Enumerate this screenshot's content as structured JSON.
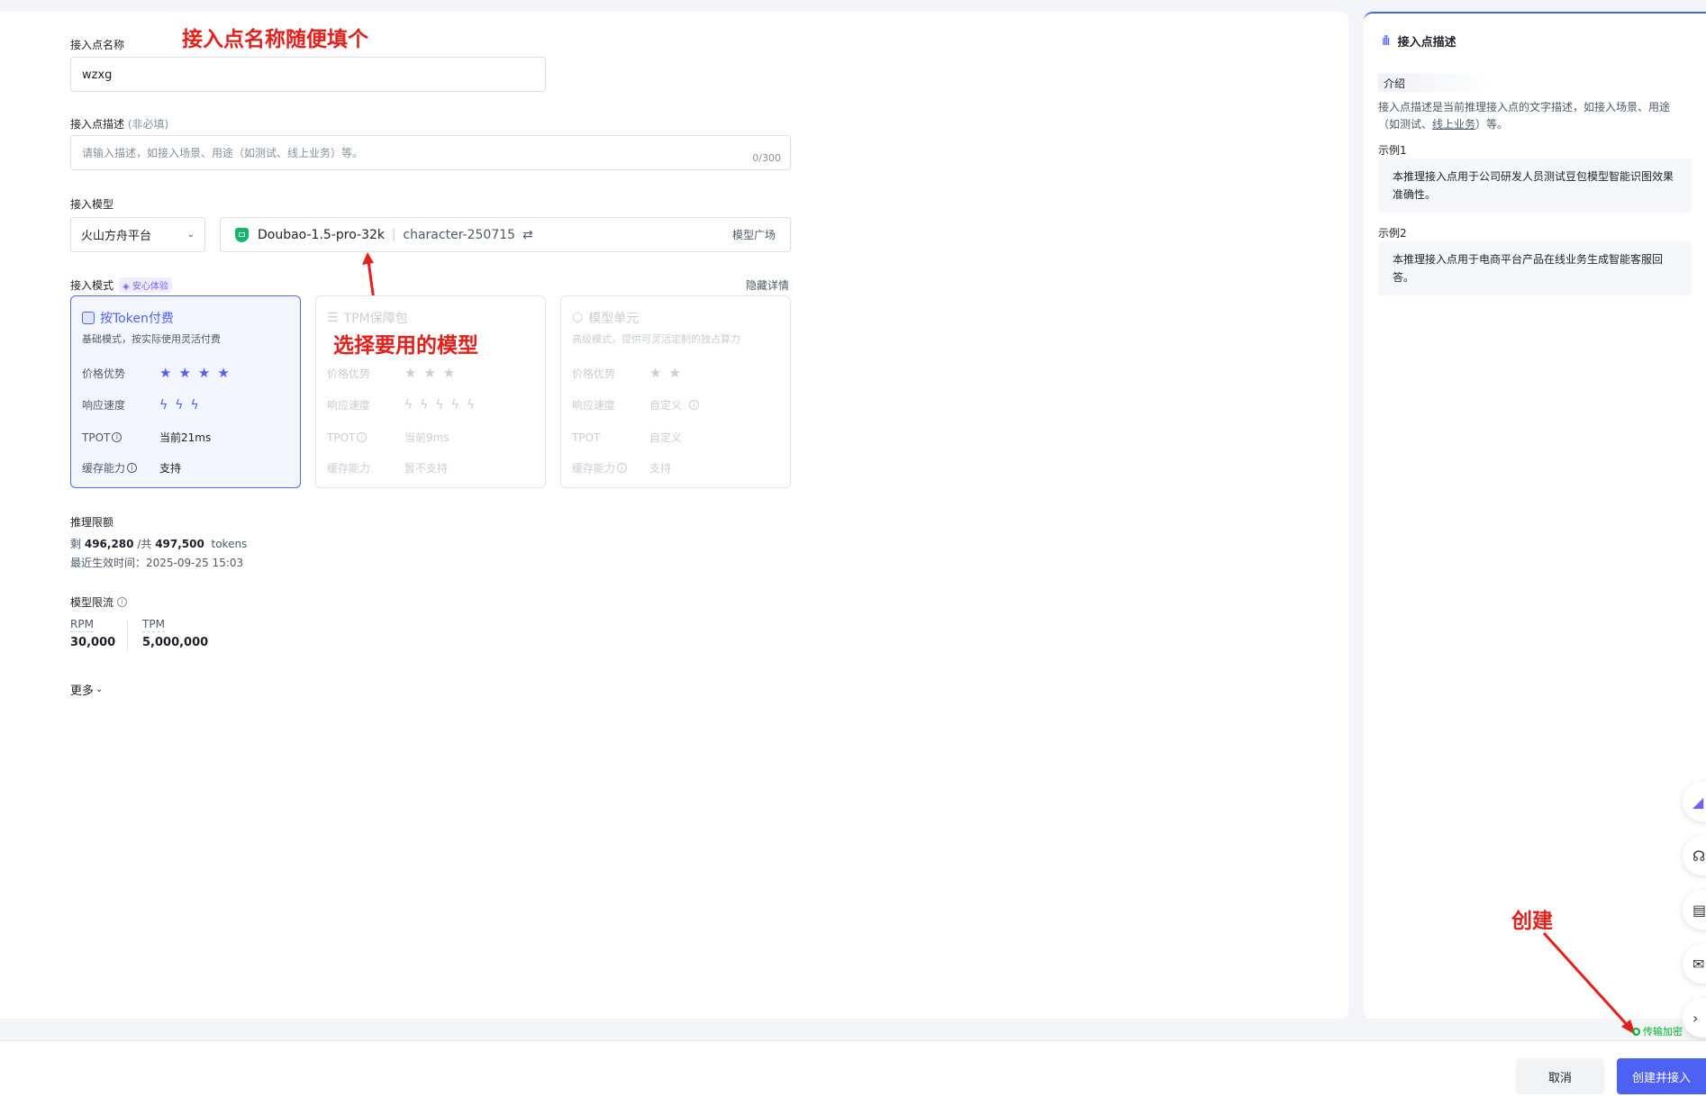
{
  "form": {
    "name_label": "接入点名称",
    "name_value": "wzxg",
    "desc_label": "接入点描述",
    "desc_optional": "(非必填)",
    "desc_placeholder": "请输入描述，如接入场景、用途（如测试、线上业务）等。",
    "desc_counter": "0/300",
    "model_label": "接入模型",
    "platform_value": "火山方舟平台",
    "model_name": "Doubao-1.5-pro-32k",
    "model_version": "character-250715",
    "model_square": "模型广场",
    "mode_label": "接入模式",
    "mode_badge": "安心体验",
    "hide_details": "隐藏详情"
  },
  "cards": [
    {
      "title": "按Token付费",
      "subtitle": "基础模式，按实际使用灵活付费",
      "price_label": "价格优势",
      "price_stars": 4,
      "speed_label": "响应速度",
      "speed_bolts": 3,
      "tpot_label": "TPOT",
      "tpot_value": "当前21ms",
      "cache_label": "缓存能力",
      "cache_value": "支持"
    },
    {
      "title": "TPM保障包",
      "subtitle": "",
      "price_label": "价格优势",
      "price_stars": 3,
      "speed_label": "响应速度",
      "speed_bolts": 5,
      "tpot_label": "TPOT",
      "tpot_value": "当前9ms",
      "cache_label": "缓存能力",
      "cache_value": "暂不支持"
    },
    {
      "title": "模型单元",
      "subtitle": "高级模式，提供可灵活定制的独占算力",
      "price_label": "价格优势",
      "price_stars": 2,
      "speed_label": "响应速度",
      "speed_value": "自定义",
      "tpot_label": "TPOT",
      "tpot_value": "自定义",
      "cache_label": "缓存能力",
      "cache_value": "支持"
    }
  ],
  "quota": {
    "title": "推理限额",
    "remain_prefix": "剩",
    "remain": "496,280",
    "total_prefix": "/共",
    "total": "497,500",
    "unit": "tokens",
    "effective": "最近生效时间：2025-09-25 15:03"
  },
  "ratelimit": {
    "title": "模型限流",
    "rpm_label": "RPM",
    "rpm_value": "30,000",
    "tpm_label": "TPM",
    "tpm_value": "5,000,000"
  },
  "more": "更多",
  "side": {
    "title": "接入点描述",
    "intro_tag": "介绍",
    "intro_text_1": "接入点描述是当前推理接入点的文字描述，如接入场景、用途",
    "intro_text_2": "（如测试、",
    "intro_link": "线上业务",
    "intro_text_3": "）等。",
    "ex1_label": "示例1",
    "ex1_text": "本推理接入点用于公司研发人员测试豆包模型智能识图效果准确性。",
    "ex2_label": "示例2",
    "ex2_text": "本推理接入点用于电商平台产品在线业务生成智能客服回答。"
  },
  "footer": {
    "secure": "传输加密",
    "cancel": "取消",
    "create": "创建并接入"
  },
  "annotations": {
    "name_hint": "接入点名称随便填个",
    "model_hint": "选择要用的模型",
    "create_hint": "创建"
  },
  "colors": {
    "accent": "#4d61f5",
    "annotation": "#e3201b",
    "secure_green": "#00b42a"
  }
}
